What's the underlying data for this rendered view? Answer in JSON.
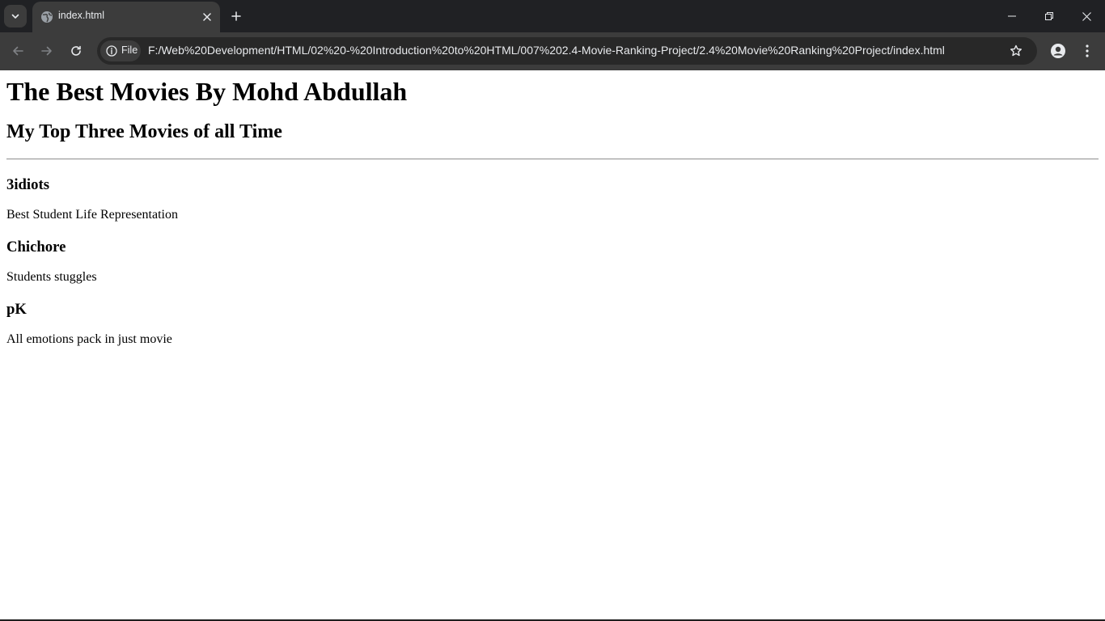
{
  "browser": {
    "tab": {
      "title": "index.html"
    },
    "omnibox": {
      "chip_label": "File",
      "url": "F:/Web%20Development/HTML/02%20-%20Introduction%20to%20HTML/007%202.4-Movie-Ranking-Project/2.4%20Movie%20Ranking%20Project/index.html"
    },
    "icons": {
      "tab_search": "chevron-down-icon",
      "favicon": "globe-icon",
      "tab_close": "close-icon",
      "new_tab": "plus-icon",
      "minimize": "minimize-icon",
      "maximize": "restore-icon",
      "window_close": "close-icon",
      "back": "arrow-left-icon",
      "forward": "arrow-right-icon",
      "reload": "reload-icon",
      "info": "info-icon",
      "bookmark": "star-icon",
      "profile": "person-icon",
      "menu": "kebab-menu-icon"
    },
    "colors": {
      "tabstrip_bg": "#202124",
      "toolbar_bg": "#3c3c3c",
      "omnibox_bg": "#282828",
      "text_light": "#e8eaed"
    }
  },
  "page": {
    "title": "The Best Movies By Mohd Abdullah",
    "subtitle": "My Top Three Movies of all Time",
    "movies": [
      {
        "name": "3idiots",
        "description": "Best Student Life Representation"
      },
      {
        "name": "Chichore",
        "description": "Students stuggles"
      },
      {
        "name": "pK",
        "description": "All emotions pack in just movie"
      }
    ]
  }
}
